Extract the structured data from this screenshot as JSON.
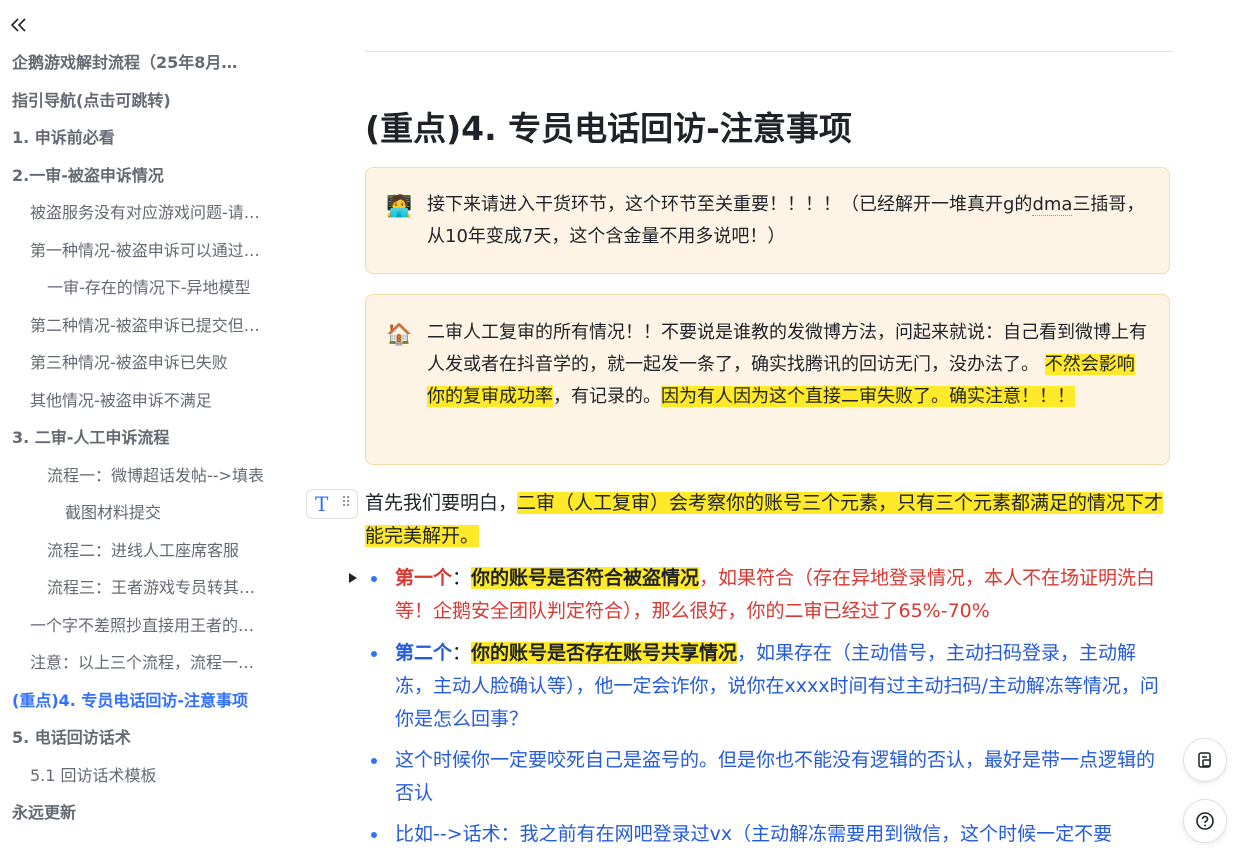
{
  "sidebar": {
    "collapse_icon": "double-chevron-left-icon",
    "toc": [
      {
        "label": "企鹅游戏解封流程（25年8月…",
        "level": 1
      },
      {
        "label": "指引导航(点击可跳转)",
        "level": 1
      },
      {
        "label": "1. 申诉前必看",
        "level": 1
      },
      {
        "label": "2.一审-被盗申诉情况",
        "level": 1
      },
      {
        "label": "被盗服务没有对应游戏问题-请…",
        "level": 2
      },
      {
        "label": "第一种情况-被盗申诉可以通过…",
        "level": 2
      },
      {
        "label": "一审-存在的情况下-异地模型",
        "level": 3
      },
      {
        "label": "第二种情况-被盗申诉已提交但…",
        "level": 2
      },
      {
        "label": "第三种情况-被盗申诉已失败",
        "level": 2
      },
      {
        "label": "其他情况-被盗申诉不满足",
        "level": 2
      },
      {
        "label": "3. 二审-人工申诉流程",
        "level": 1
      },
      {
        "label": "流程一：微博超话发帖-->填表",
        "level": 3
      },
      {
        "label": "截图材料提交",
        "level": 4
      },
      {
        "label": "流程二：进线人工座席客服",
        "level": 3
      },
      {
        "label": "流程三：王者游戏专员转其…",
        "level": 3
      },
      {
        "label": "一个字不差照抄直接用王者的…",
        "level": 2
      },
      {
        "label": "注意：以上三个流程，流程一…",
        "level": 2
      },
      {
        "label": "(重点)4. 专员电话回访-注意事项",
        "level": 1,
        "active": true
      },
      {
        "label": "5. 电话回访话术",
        "level": 1
      },
      {
        "label": "5.1 回访话术模板",
        "level": 2
      },
      {
        "label": "永远更新",
        "level": 1
      }
    ]
  },
  "doc": {
    "title": "(重点)4. 专员电话回访-注意事项",
    "callout1": {
      "emoji": "🧑‍💻",
      "text_a": "接下来请进入干货环节，这个环节至关重要！！！！（已经解开一堆真开g的",
      "text_dotted": "dma",
      "text_b": "三插哥，从10年变成7天，这个含金量不用多说吧！）"
    },
    "callout2": {
      "emoji": "🏠",
      "text_a": "二审人工复审的所有情况！！不要说是谁教的发微博方法，问起来就说：自己看到微博上有人发或者在抖音学的，就一起发一条了，确实找腾讯的回访无门，没办法了。",
      "hl1": "不然会影响你的复审成功率",
      "text_b": "，有记录的。",
      "hl2": "因为有人因为这个直接二审失败了。确实注意！！！"
    },
    "para": {
      "text_a": "首先我们要明白，",
      "hl": "二审（人工复审）会考察你的账号三个元素，只有三个元素都满足的情况下才能完美解开。"
    },
    "bullets": [
      {
        "lead": "第一个",
        "colon": "：",
        "hl": "你的账号是否符合被盗情况",
        "rest": "，如果符合（存在异地登录情况，本人不在场证明洗白等！企鹅安全团队判定符合），那么很好，你的二审已经过了65%-70%"
      },
      {
        "lead": "第二个",
        "colon": "：",
        "hl": "你的账号是否存在账号共享情况",
        "rest": "，如果存在（主动借号，主动扫码登录，主动解冻，主动人脸确认等），他一定会诈你，说你在xxxx时间有过主动扫码/主动解冻等情况，问你是怎么回事？"
      },
      {
        "text": "这个时候你一定要咬死自己是盗号的。但是你也不能没有逻辑的否认，最好是带一点逻辑的否认"
      },
      {
        "text": "比如-->话术：我之前有在网吧登录过vx（主动解冻需要用到微信，这个时候一定不要"
      }
    ]
  },
  "tools": {
    "text_type_glyph": "T",
    "grip_glyph": "⠿",
    "fab1_icon": "outline-icon",
    "fab2_icon": "help-icon"
  },
  "colors": {
    "accent": "#3370ff",
    "highlight": "#ffe928",
    "callout_bg": "#fef4e5",
    "callout_border": "#f8d9aa",
    "red_text": "#d83931",
    "blue_text": "#245bdb"
  }
}
